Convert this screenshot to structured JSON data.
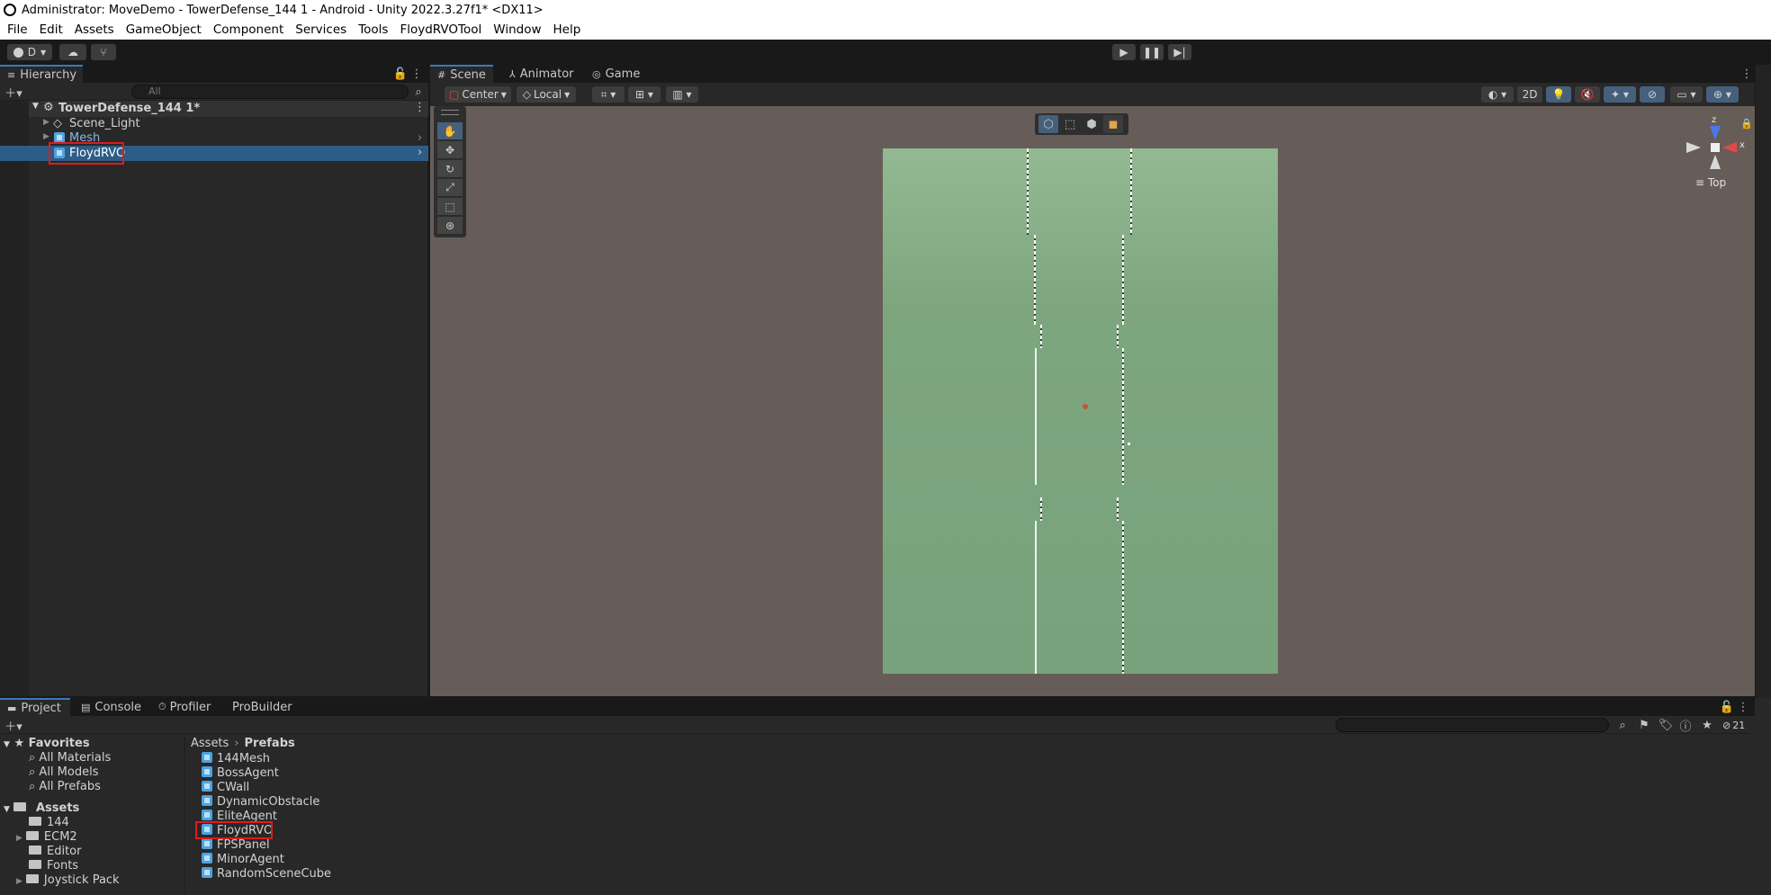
{
  "window": {
    "title": "Administrator: MoveDemo - TowerDefense_144 1 - Android - Unity 2022.3.27f1* <DX11>"
  },
  "menu": [
    "File",
    "Edit",
    "Assets",
    "GameObject",
    "Component",
    "Services",
    "Tools",
    "FloydRVOTool",
    "Window",
    "Help"
  ],
  "toolbar": {
    "account_label": "D",
    "play_icon": "play-icon",
    "pause_icon": "pause-icon",
    "step_icon": "step-icon"
  },
  "hierarchy": {
    "tab_label": "Hierarchy",
    "search_placeholder": "All",
    "scene_name": "TowerDefense_144 1*",
    "items": [
      {
        "label": "Scene_Light",
        "icon": "gameobject-icon"
      },
      {
        "label": "Mesh",
        "icon": "prefab-icon"
      },
      {
        "label": "FloydRVO",
        "icon": "prefab-icon",
        "selected": true
      }
    ]
  },
  "scene_view": {
    "tabs": [
      "Scene",
      "Animator",
      "Game"
    ],
    "pivot_label": "Center",
    "space_label": "Local",
    "mode_2d_label": "2D",
    "orientation_label": "Top",
    "axis_labels": {
      "y": "z",
      "x": "x"
    }
  },
  "bottom_panel": {
    "tabs": [
      "Project",
      "Console",
      "Profiler",
      "ProBuilder"
    ],
    "hidden_count": "21",
    "favorites_label": "Favorites",
    "favorites": [
      "All Materials",
      "All Models",
      "All Prefabs"
    ],
    "assets_label": "Assets",
    "asset_folders": [
      "144",
      "ECM2",
      "Editor",
      "Fonts",
      "Joystick Pack"
    ],
    "breadcrumb": [
      "Assets",
      "Prefabs"
    ],
    "files": [
      "144Mesh",
      "BossAgent",
      "CWall",
      "DynamicObstacle",
      "EliteAgent",
      "FloydRVO",
      "FPSPanel",
      "MinorAgent",
      "RandomSceneCube"
    ]
  },
  "colors": {
    "accent": "#3a79bb",
    "selection": "#2c5d87",
    "highlight_box": "#e01b1b",
    "prefab": "#4ea3e0"
  }
}
